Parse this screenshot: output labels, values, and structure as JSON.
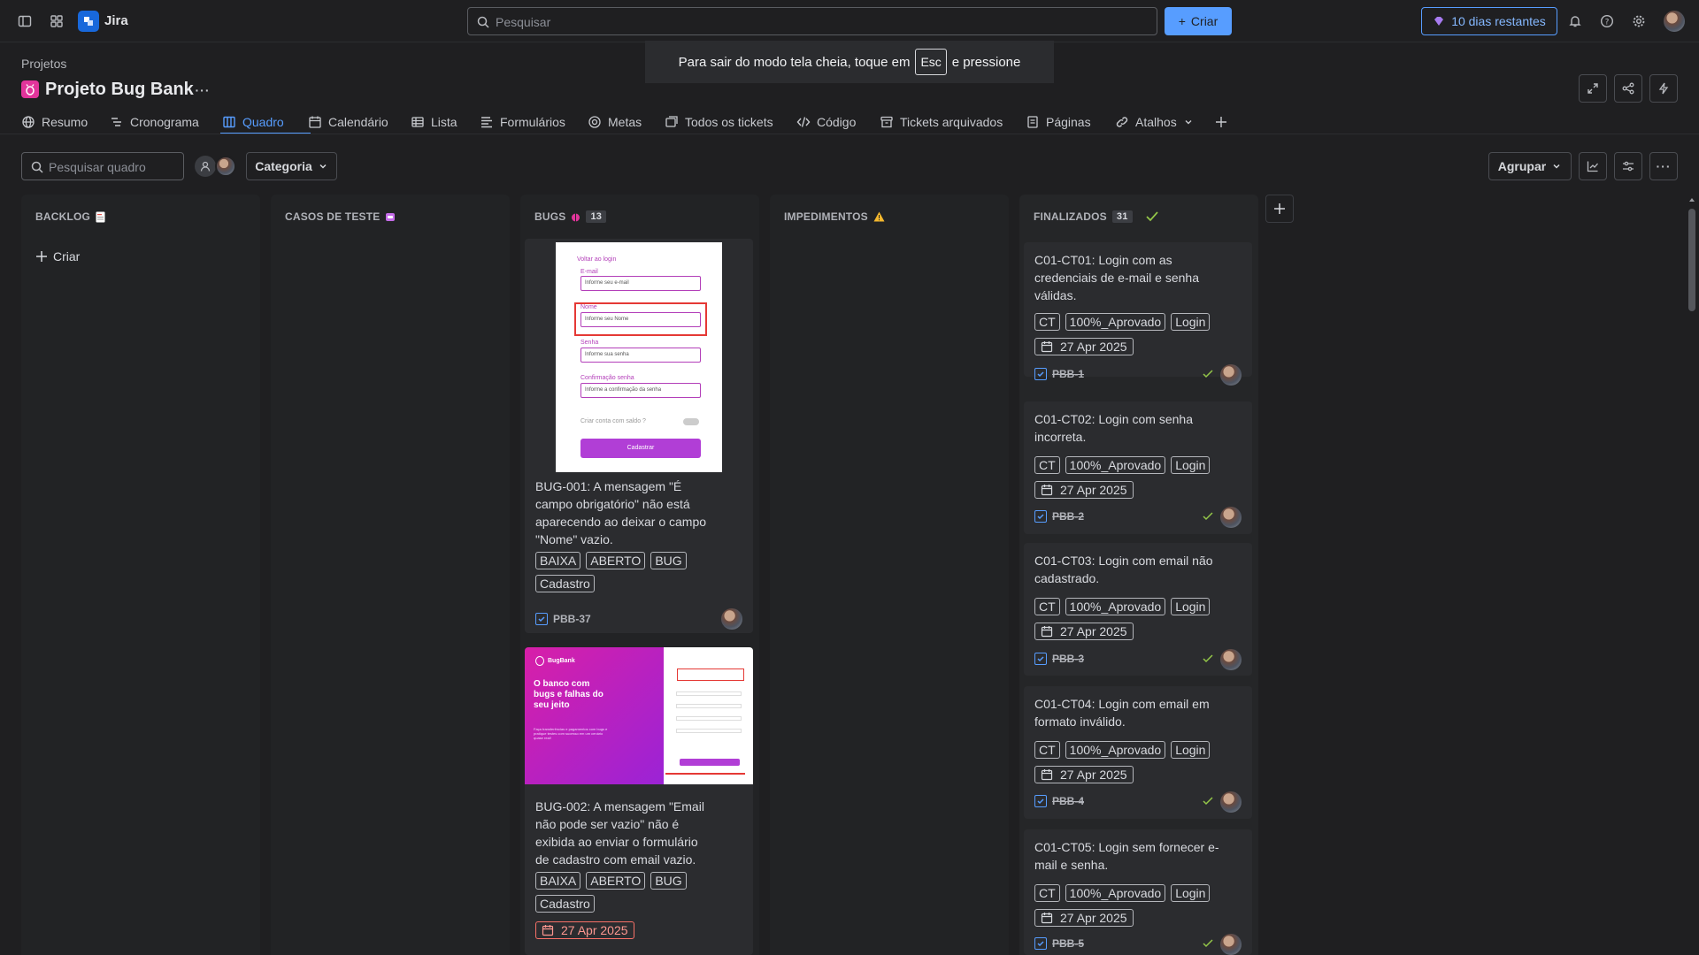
{
  "topbar": {
    "app_name": "Jira",
    "search_placeholder": "Pesquisar",
    "create_label": "Criar",
    "trial_label": "10 dias restantes"
  },
  "fullscreen_notice": {
    "before": "Para sair do modo tela cheia, toque em",
    "key": "Esc",
    "after": "e pressione"
  },
  "header": {
    "breadcrumb": "Projetos",
    "title": "Projeto Bug Bank"
  },
  "tabs": [
    "Resumo",
    "Cronograma",
    "Quadro",
    "Calendário",
    "Lista",
    "Formulários",
    "Metas",
    "Todos os tickets",
    "Código",
    "Tickets arquivados",
    "Páginas",
    "Atalhos"
  ],
  "active_tab": "Quadro",
  "toolbar": {
    "search_placeholder": "Pesquisar quadro",
    "category_label": "Categoria",
    "group_label": "Agrupar"
  },
  "columns": {
    "backlog": {
      "title": "BACKLOG",
      "create_label": "Criar"
    },
    "test_cases": {
      "title": "CASOS DE TESTE"
    },
    "bugs": {
      "title": "BUGS",
      "count": "13"
    },
    "impediments": {
      "title": "IMPEDIMENTOS"
    },
    "done": {
      "title": "FINALIZADOS",
      "count": "31"
    }
  },
  "bug_cards": [
    {
      "title": "BUG-001: A mensagem \"É campo obrigatório\" não está aparecendo ao deixar o campo \"Nome\" vazio.",
      "labels": [
        "BAIXA",
        "ABERTO",
        "BUG",
        "Cadastro"
      ],
      "key": "PBB-37",
      "mock": {
        "back": "Voltar ao login",
        "email_label": "E-mail",
        "email_ph": "Informe seu e-mail",
        "name_label": "Nome",
        "name_ph": "Informe seu Nome",
        "pwd_label": "Senha",
        "pwd_ph": "Informe sua senha",
        "confirm_label": "Confirmação senha",
        "confirm_ph": "Informe a confirmação da senha",
        "balance": "Criar conta com saldo ?",
        "submit": "Cadastrar"
      }
    },
    {
      "title": "BUG-002: A mensagem \"Email não pode ser vazio\" não é exibida ao enviar o formulário de cadastro com email vazio.",
      "labels": [
        "BAIXA",
        "ABERTO",
        "BUG",
        "Cadastro"
      ],
      "date": "27 Apr 2025",
      "mock": {
        "brand": "BugBank",
        "headline": "O banco com bugs e falhas do seu jeito",
        "sub": "Faça transferências e pagamentos com bugs e pratique testes com sucesso em um cenário quase real!"
      }
    }
  ],
  "done_cards": [
    {
      "title": "C01-CT01: Login com as credenciais de e-mail e senha válidas.",
      "labels": [
        "CT",
        "100%_Aprovado",
        "Login"
      ],
      "date": "27 Apr 2025",
      "key": "PBB-1"
    },
    {
      "title": "C01-CT02: Login com senha incorreta.",
      "labels": [
        "CT",
        "100%_Aprovado",
        "Login"
      ],
      "date": "27 Apr 2025",
      "key": "PBB-2"
    },
    {
      "title": "C01-CT03: Login com email não cadastrado.",
      "labels": [
        "CT",
        "100%_Aprovado",
        "Login"
      ],
      "date": "27 Apr 2025",
      "key": "PBB-3"
    },
    {
      "title": "C01-CT04: Login com email em formato inválido.",
      "labels": [
        "CT",
        "100%_Aprovado",
        "Login"
      ],
      "date": "27 Apr 2025",
      "key": "PBB-4"
    },
    {
      "title": "C01-CT05: Login sem fornecer e-mail e senha.",
      "labels": [
        "CT",
        "100%_Aprovado",
        "Login"
      ],
      "date": "27 Apr 2025",
      "key": "PBB-5"
    }
  ],
  "colors": {
    "accent": "#579dff",
    "background": "#1f1f21",
    "column": "#222325",
    "card": "#2b2c2f",
    "project_icon": "#e2349b",
    "overdue": "#f87168"
  }
}
